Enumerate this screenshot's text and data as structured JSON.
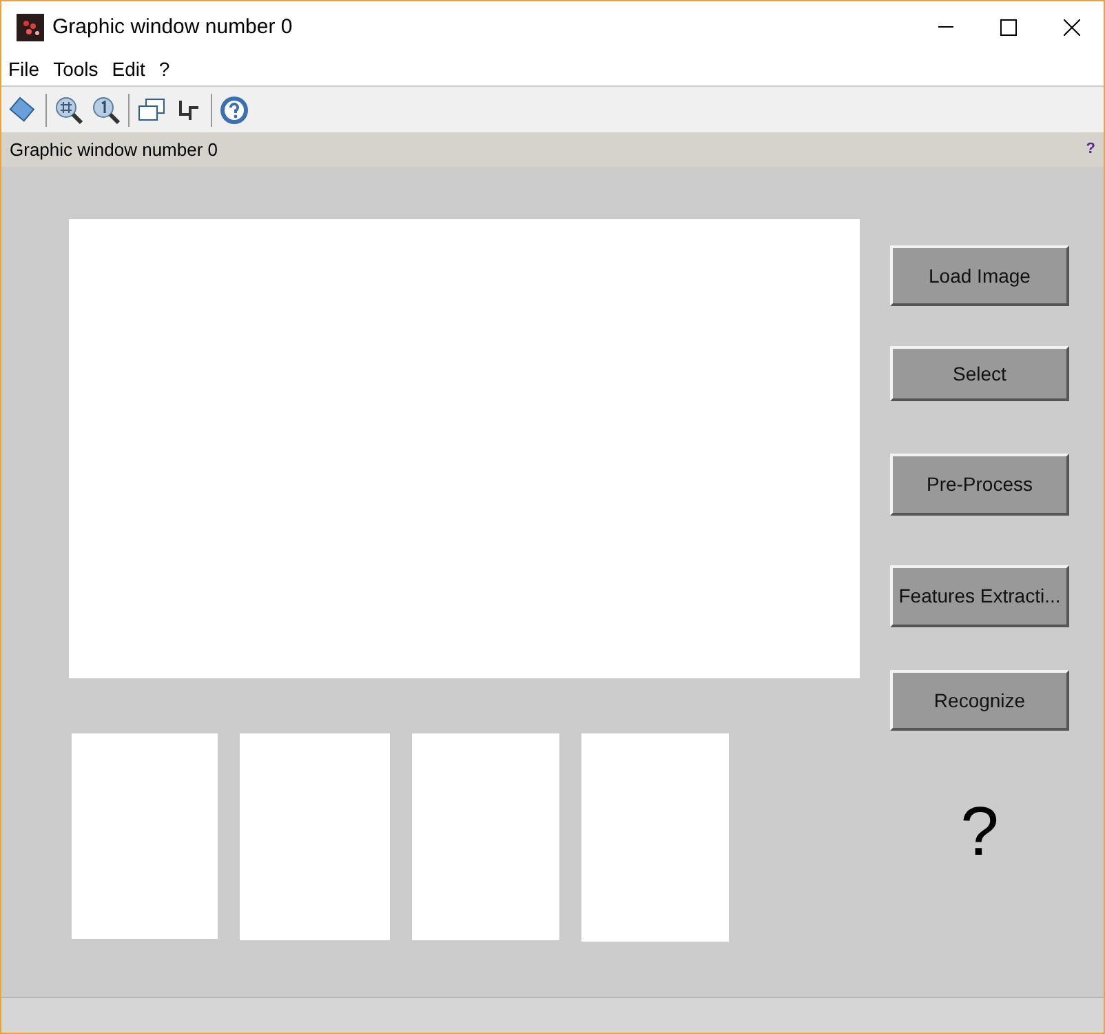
{
  "window": {
    "title": "Graphic window number 0"
  },
  "menu": [
    "File",
    "Tools",
    "Edit",
    "?"
  ],
  "info_bar": {
    "title": "Graphic window number 0",
    "help": "?"
  },
  "buttons": [
    "Load Image",
    "Select",
    "Pre-Process",
    "Features Extracti...",
    "Recognize"
  ],
  "result": "?"
}
